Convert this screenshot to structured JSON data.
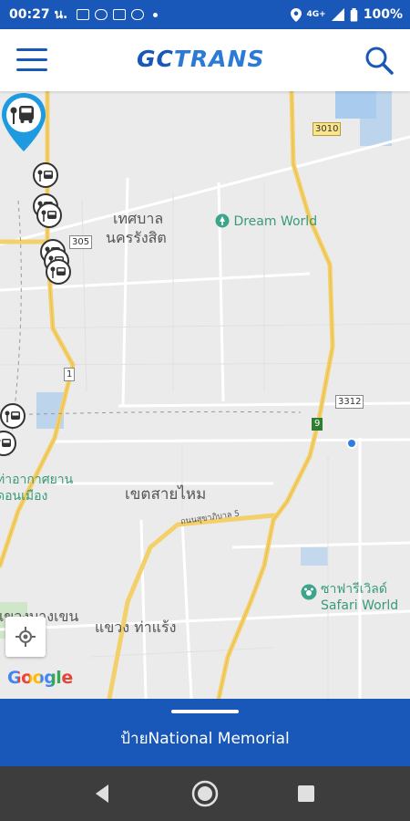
{
  "statusbar": {
    "time": "00:27 น.",
    "network": "4G+",
    "battery": "100%"
  },
  "appbar": {
    "logo_gc": "GC",
    "logo_trans": "TRANS",
    "menu_icon": "hamburger-menu-icon",
    "search_icon": "search-icon"
  },
  "map": {
    "labels": {
      "area1_line1": "เทศบาล",
      "area1_line2": "นครรังสิต",
      "dreamworld": "Dream World",
      "saimai": "เขตสายไหม",
      "bangkhen": "แขวงบางเขน",
      "tharaeng": "แขวง ท่าแร้ง",
      "safari_th": "ซาฟารีเวิลด์",
      "safari_en": "Safari World",
      "airport_line1": "ท่าอากาศยาน",
      "airport_line2": "ดอนเมือง",
      "road_small": "ถนนสุขาภิบาล 5"
    },
    "route_badges": {
      "r3010": "3010",
      "r305": "305",
      "r3312": "3312",
      "r1": "1",
      "r9": "9"
    },
    "attribution": "Google"
  },
  "bottom_sheet": {
    "title": "ป้ายNational Memorial"
  },
  "colors": {
    "primary": "#1958b8",
    "accent": "#2c7ad6",
    "highway": "#f4d06b",
    "nav_bar": "#3d3d3d"
  }
}
